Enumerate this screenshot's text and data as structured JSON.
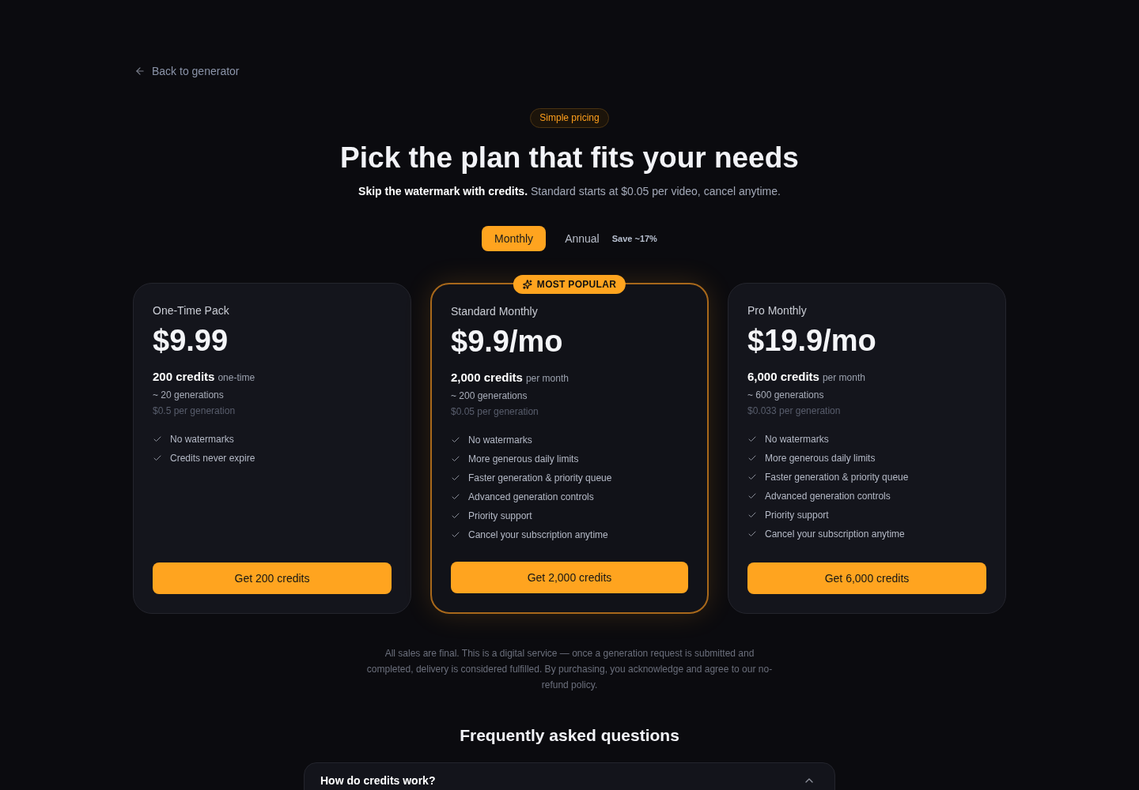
{
  "back_link": {
    "label": "Back to generator"
  },
  "hero": {
    "badge": "Simple pricing",
    "title": "Pick the plan that fits your needs",
    "subtitle": "**Skip the watermark with credits.** Standard starts at $0.05 per video, cancel anytime."
  },
  "billing_toggle": [
    {
      "label": "Monthly",
      "selected": true
    },
    {
      "label": "Annual",
      "selected": false,
      "note": "Save ~17%"
    }
  ],
  "plans": [
    {
      "name": "One-Time Pack",
      "price": "$9.99",
      "credits": "200 credits",
      "credits_period": "one-time",
      "generations": "~ 20 generations",
      "per_generation": "$0.5 per generation",
      "features": [
        "No watermarks",
        "Credits never expire"
      ],
      "button": "Get 200 credits",
      "featured": false
    },
    {
      "name": "Standard Monthly",
      "price": "$9.9/mo",
      "credits": "2,000 credits",
      "credits_period": "per month",
      "generations": "~ 200 generations",
      "per_generation": "$0.05 per generation",
      "features": [
        "No watermarks",
        "More generous daily limits",
        "Faster generation & priority queue",
        "Advanced generation controls",
        "Priority support",
        "Cancel your subscription anytime"
      ],
      "button": "Get 2,000 credits",
      "featured": true,
      "badge": "MOST POPULAR"
    },
    {
      "name": "Pro Monthly",
      "price": "$19.9/mo",
      "credits": "6,000 credits",
      "credits_period": "per month",
      "generations": "~ 600 generations",
      "per_generation": "$0.033 per generation",
      "features": [
        "No watermarks",
        "More generous daily limits",
        "Faster generation & priority queue",
        "Advanced generation controls",
        "Priority support",
        "Cancel your subscription anytime"
      ],
      "button": "Get 6,000 credits",
      "featured": false
    }
  ],
  "disclaimer": "All sales are final. This is a digital service — once a generation request is submitted and completed, delivery is considered fulfilled. By purchasing, you acknowledge and agree to our no-refund policy.",
  "faq": {
    "title": "Frequently asked questions",
    "items": [
      {
        "question": "How do credits work?",
        "expanded": true
      }
    ]
  }
}
